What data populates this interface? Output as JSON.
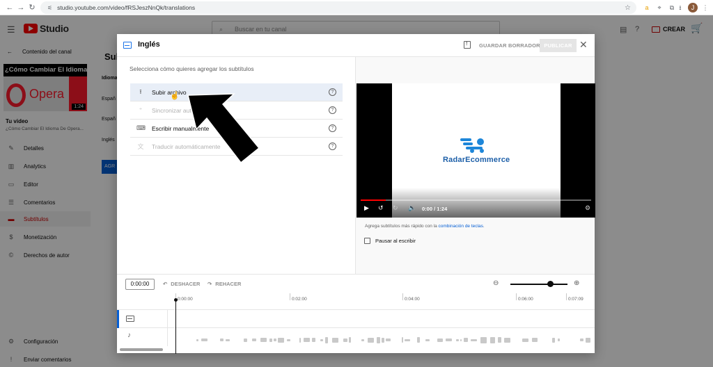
{
  "browser": {
    "url": "studio.youtube.com/video/fRSJeszNnQk/translations",
    "nav_back": "←",
    "nav_forward": "→",
    "nav_reload": "↻",
    "ext_icons": [
      "★",
      "a",
      "⌖",
      "⧉",
      "⭳",
      "J",
      "⋮"
    ]
  },
  "studio": {
    "logo_text": "Studio",
    "search_placeholder": "Buscar en tu canal",
    "create_label": "CREAR"
  },
  "sidebar": {
    "back_label": "Contenido del canal",
    "thumbnail": {
      "title_text": "¿Cómo Cambiar El Idioma?",
      "logo_text": "Opera",
      "duration": "1:24"
    },
    "your_video_label": "Tu video",
    "video_subtitle": "¿Cómo Cambiar El Idioma De Opera...",
    "items": [
      {
        "label": "Detalles",
        "icon": "✎"
      },
      {
        "label": "Analytics",
        "icon": "▥"
      },
      {
        "label": "Editor",
        "icon": "▭"
      },
      {
        "label": "Comentarios",
        "icon": "☰"
      },
      {
        "label": "Subtítulos",
        "icon": "▬",
        "active": true
      },
      {
        "label": "Monetización",
        "icon": "$"
      },
      {
        "label": "Derechos de autor",
        "icon": "©"
      }
    ],
    "bottom_items": [
      {
        "label": "Configuración",
        "icon": "⚙"
      },
      {
        "label": "Enviar comentarios",
        "icon": "!"
      }
    ]
  },
  "underlay": {
    "title": "Subt",
    "labels": [
      "Idioma",
      "Españ",
      "Españ",
      "Inglés"
    ],
    "button": "AGR"
  },
  "dialog": {
    "title": "Inglés",
    "save_draft": "GUARDAR BORRADOR",
    "publish": "PUBLICAR",
    "prompt": "Selecciona cómo quieres agregar los subtítulos",
    "options": [
      {
        "label": "Subir archivo",
        "icon": "⭱",
        "selected": true,
        "enabled": true
      },
      {
        "label": "Sincronizar automáticamente",
        "icon": "⁺",
        "enabled": false
      },
      {
        "label": "Escribir manualmente",
        "icon": "⌨",
        "enabled": true
      },
      {
        "label": "Traducir automáticamente",
        "icon": "文",
        "enabled": false
      }
    ],
    "help_glyph": "?",
    "player": {
      "brand": "RadarEcommerce",
      "time": "0:00 / 1:24",
      "progress": 0.11
    },
    "keyboard_note_prefix": "Agrega subtítulos más rápido con la ",
    "keyboard_note_link": "combinación de teclas",
    "keyboard_note_suffix": ".",
    "pause_label": "Pausar al escribir",
    "timeline": {
      "timecode": "0:00:00",
      "undo": "DESHACER",
      "redo": "REHACER",
      "zoom_level": 0.7,
      "ticks": [
        "0:00:00",
        "0:02:00",
        "0:04:00",
        "0:06:00",
        "0:07:09"
      ]
    }
  }
}
